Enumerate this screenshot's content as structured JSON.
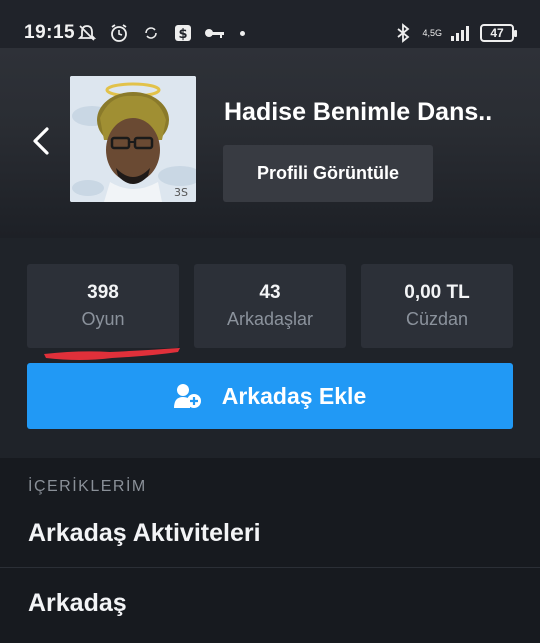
{
  "status_bar": {
    "time": "19:15",
    "network_label": "4,5G",
    "battery": "47",
    "icons": [
      "muted-bell-icon",
      "alarm-icon",
      "sync-icon",
      "dollar-icon",
      "key-icon",
      "bluetooth-icon",
      "signal-icon"
    ]
  },
  "header": {
    "back_icon": "chevron-left-icon",
    "profile_name": "Hadise Benimle Dans..",
    "view_profile_label": "Profili Görüntüle"
  },
  "stats": [
    {
      "value": "398",
      "label": "Oyun"
    },
    {
      "value": "43",
      "label": "Arkadaşlar"
    },
    {
      "value": "0,00 TL",
      "label": "Cüzdan"
    }
  ],
  "add_friend": {
    "label": "Arkadaş Ekle",
    "icon": "add-user-icon"
  },
  "content": {
    "section_title": "İÇERİKLERİM",
    "items": [
      "Arkadaş Aktiviteleri",
      "Arkadaş"
    ]
  },
  "colors": {
    "accent": "#2199f5",
    "annotation": "#e0303a"
  }
}
